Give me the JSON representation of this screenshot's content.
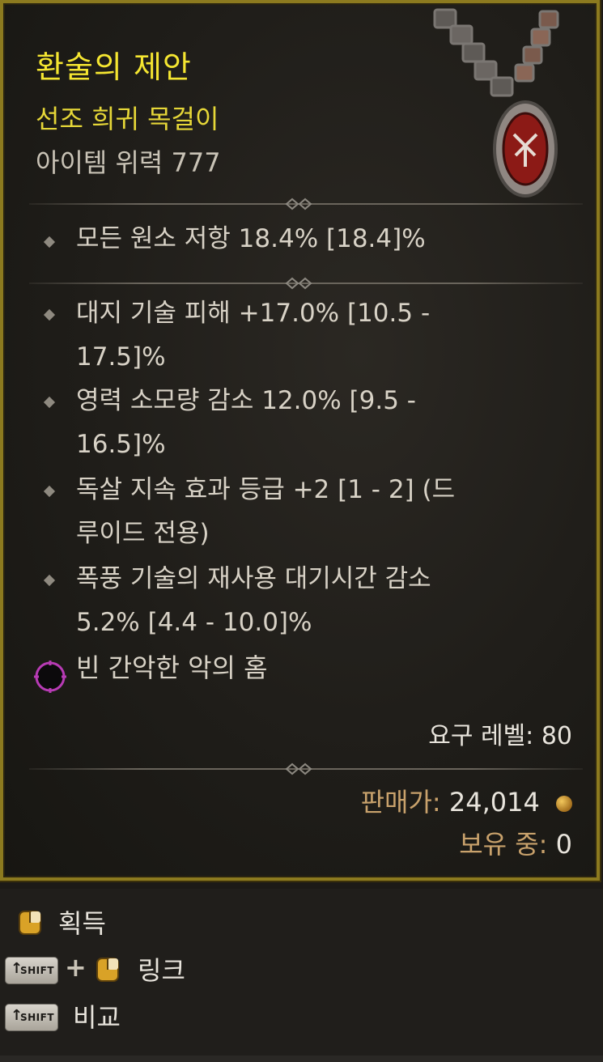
{
  "item": {
    "name": "환술의 제안",
    "type": "선조 희귀 목걸이",
    "power": "아이템 위력 777"
  },
  "implicit_affixes": [
    {
      "text": "모든 원소 저항 18.4% [18.4]%"
    }
  ],
  "affixes": [
    {
      "line1": "대지 기술 피해 +17.0% [10.5 -",
      "line2": "17.5]%"
    },
    {
      "line1": "영력 소모량 감소 12.0% [9.5 -",
      "line2": "16.5]%"
    },
    {
      "line1": "독살 지속 효과 등급 +2 [1 - 2] (드",
      "line2": "루이드 전용)"
    },
    {
      "line1": "폭풍 기술의 재사용 대기시간 감소",
      "line2": "5.2% [4.4 - 10.0]%"
    }
  ],
  "socket": {
    "label": "빈 간악한 악의 홈",
    "icon": "socket-icon",
    "color": "#b83bb5"
  },
  "requirement": "요구 레벨: 80",
  "sell": {
    "label": "판매가:",
    "value": "24,014",
    "icon": "gold-coin-icon"
  },
  "owned": {
    "label": "보유 중:",
    "value": "0"
  },
  "controls": [
    {
      "label": "획득",
      "icon": "mouse-right-click-icon"
    },
    {
      "label": "링크",
      "keys": [
        "SHIFT",
        "+"
      ],
      "icon": "mouse-right-click-icon"
    },
    {
      "label": "비교",
      "keys": [
        "SHIFT"
      ]
    }
  ],
  "colors": {
    "title": "#f5e631",
    "border": "#8c7a1f",
    "sell_label": "#c9a26c"
  }
}
